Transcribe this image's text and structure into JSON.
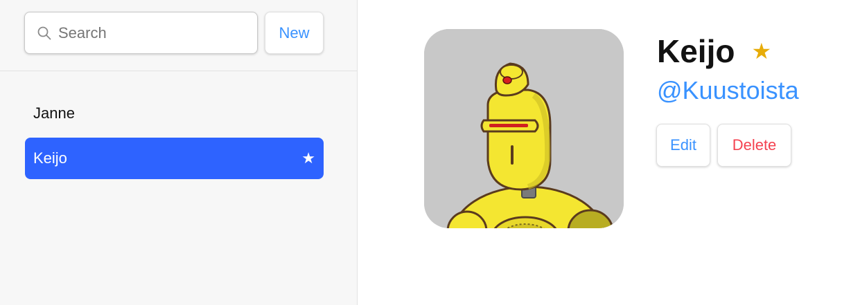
{
  "sidebar": {
    "search": {
      "placeholder": "Search",
      "value": ""
    },
    "new_label": "New",
    "contacts": [
      {
        "name": "Janne",
        "favorite": false,
        "active": false
      },
      {
        "name": "Keijo",
        "favorite": true,
        "active": true,
        "star": "★"
      }
    ]
  },
  "contact": {
    "name": "Keijo",
    "star": "★",
    "twitter": "@Kuustoista",
    "edit_label": "Edit",
    "delete_label": "Delete",
    "avatar_icon": "yellow-robot-avatar"
  },
  "colors": {
    "accent": "#3992ff",
    "active_bg": "#2e63ff",
    "danger": "#f44250",
    "star": "#e7ac09",
    "sidebar_bg": "#f7f7f7"
  }
}
